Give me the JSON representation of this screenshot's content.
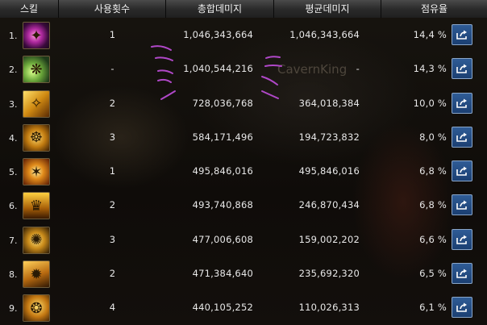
{
  "columns": {
    "skill": "스킬",
    "count": "사용횟수",
    "total": "총합데미지",
    "avg": "평균데미지",
    "share": "점유율"
  },
  "background_text": "CavernKing",
  "rows": [
    {
      "index": "1.",
      "icon": "skill-icon-1",
      "count": "1",
      "total": "1,046,343,664",
      "avg": "1,046,343,664",
      "share": "14,4 %"
    },
    {
      "index": "2.",
      "icon": "skill-icon-2",
      "count": "-",
      "total": "1,040,544,216",
      "avg": "-",
      "share": "14,3 %"
    },
    {
      "index": "3.",
      "icon": "skill-icon-3",
      "count": "2",
      "total": "728,036,768",
      "avg": "364,018,384",
      "share": "10,0 %"
    },
    {
      "index": "4.",
      "icon": "skill-icon-4",
      "count": "3",
      "total": "584,171,496",
      "avg": "194,723,832",
      "share": "8,0 %"
    },
    {
      "index": "5.",
      "icon": "skill-icon-5",
      "count": "1",
      "total": "495,846,016",
      "avg": "495,846,016",
      "share": "6,8 %"
    },
    {
      "index": "6.",
      "icon": "skill-icon-6",
      "count": "2",
      "total": "493,740,868",
      "avg": "246,870,434",
      "share": "6,8 %"
    },
    {
      "index": "7.",
      "icon": "skill-icon-7",
      "count": "3",
      "total": "477,006,608",
      "avg": "159,002,202",
      "share": "6,6 %"
    },
    {
      "index": "8.",
      "icon": "skill-icon-8",
      "count": "2",
      "total": "471,384,640",
      "avg": "235,692,320",
      "share": "6,5 %"
    },
    {
      "index": "9.",
      "icon": "skill-icon-9",
      "count": "4",
      "total": "440,105,252",
      "avg": "110,026,313",
      "share": "6,1 %"
    }
  ],
  "export_icon": "export-icon",
  "colors": {
    "header_bg": "#2b2b2b",
    "button_blue": "#1b3f72",
    "annotation": "#b048c8"
  }
}
